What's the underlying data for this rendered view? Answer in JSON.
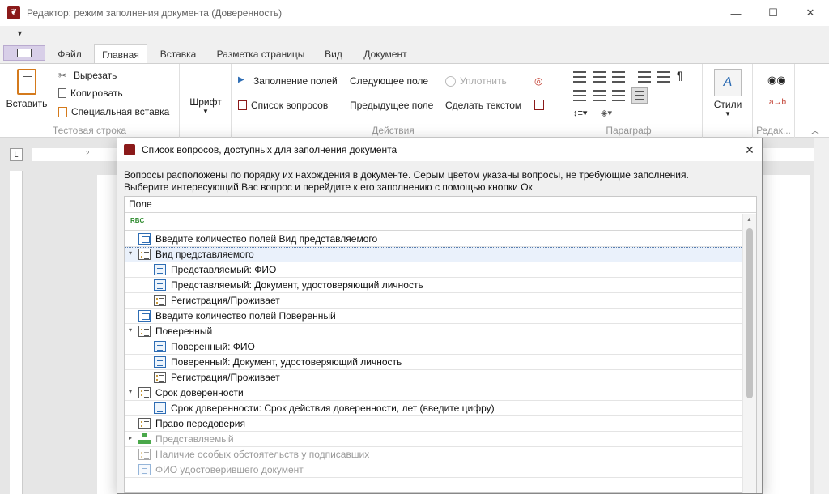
{
  "window": {
    "title": "Редактор: режим заполнения документа (Доверенность)",
    "minimize": "—",
    "maximize": "☐",
    "close": "✕"
  },
  "ribbon_tabs": [
    "Файл",
    "Главная",
    "Вставка",
    "Разметка страницы",
    "Вид",
    "Документ"
  ],
  "active_tab": "Главная",
  "clipboard_group": {
    "paste": "Вставить",
    "cut": "Вырезать",
    "copy": "Копировать",
    "paste_special": "Специальная вставка",
    "label": "Тестовая строка"
  },
  "font_group": {
    "font": "Шрифт"
  },
  "actions_group": {
    "fill_fields": "Заполнение полей",
    "questions_list": "Список вопросов",
    "next_field": "Следующее поле",
    "prev_field": "Предыдущее поле",
    "compact": "Уплотнить",
    "make_text": "Сделать текстом",
    "label": "Действия"
  },
  "paragraph_group": {
    "label": "Параграф"
  },
  "styles_group": {
    "styles": "Стили"
  },
  "editing_group": {
    "label": "Редак..."
  },
  "ruler": {
    "corner": "L",
    "tick": "2"
  },
  "dialog": {
    "title": "Список вопросов, доступных для заполнения документа",
    "close": "✕",
    "description_line1": "Вопросы расположены по порядку их нахождения в документе. Серым цветом указаны вопросы, не требующие заполнения.",
    "description_line2": "Выберите интересующий Вас вопрос и перейдите к его заполнению с помощью кнопки Ок",
    "column_header": "Поле",
    "filter_icon_text": "RBC",
    "rows": [
      {
        "label": "Введите количество полей Вид представляемого",
        "level": 0,
        "icon": "count-icon",
        "expander": "",
        "gray": false,
        "selected": false
      },
      {
        "label": "Вид представляемого",
        "level": 0,
        "icon": "list-icon",
        "expander": "▾",
        "gray": false,
        "selected": true
      },
      {
        "label": "Представляемый: ФИО",
        "level": 1,
        "icon": "field-icon",
        "expander": "",
        "gray": false,
        "selected": false
      },
      {
        "label": "Представляемый: Документ, удостоверяющий личность",
        "level": 1,
        "icon": "field-icon",
        "expander": "",
        "gray": false,
        "selected": false
      },
      {
        "label": "Регистрация/Проживает",
        "level": 1,
        "icon": "list-icon",
        "expander": "",
        "gray": false,
        "selected": false
      },
      {
        "label": "Введите количество полей Поверенный",
        "level": 0,
        "icon": "count-icon",
        "expander": "",
        "gray": false,
        "selected": false
      },
      {
        "label": "Поверенный",
        "level": 0,
        "icon": "list-icon",
        "expander": "▾",
        "gray": false,
        "selected": false
      },
      {
        "label": "Поверенный: ФИО",
        "level": 1,
        "icon": "field-icon",
        "expander": "",
        "gray": false,
        "selected": false
      },
      {
        "label": "Поверенный: Документ, удостоверяющий личность",
        "level": 1,
        "icon": "field-icon",
        "expander": "",
        "gray": false,
        "selected": false
      },
      {
        "label": "Регистрация/Проживает",
        "level": 1,
        "icon": "list-icon",
        "expander": "",
        "gray": false,
        "selected": false
      },
      {
        "label": "Срок доверенности",
        "level": 0,
        "icon": "list-icon",
        "expander": "▾",
        "gray": false,
        "selected": false
      },
      {
        "label": "Срок доверенности: Срок действия доверенности, лет (введите цифру)",
        "level": 1,
        "icon": "field-icon",
        "expander": "",
        "gray": false,
        "selected": false
      },
      {
        "label": "Право передоверия",
        "level": 0,
        "icon": "list-icon",
        "expander": "",
        "gray": false,
        "selected": false
      },
      {
        "label": "Представляемый",
        "level": 0,
        "icon": "group-icon",
        "expander": "▸",
        "gray": true,
        "selected": false
      },
      {
        "label": "Наличие особых обстоятельств у подписавших",
        "level": 0,
        "icon": "list-icon",
        "expander": "",
        "gray": true,
        "selected": false
      },
      {
        "label": "ФИО удостоверившего документ",
        "level": 0,
        "icon": "field-icon",
        "expander": "",
        "gray": true,
        "selected": false
      }
    ]
  },
  "colors": {
    "brand": "#8b1a1a",
    "accent": "#2e6db4",
    "selection": "#eaf1fb",
    "gray_text": "#9a9a9a"
  }
}
